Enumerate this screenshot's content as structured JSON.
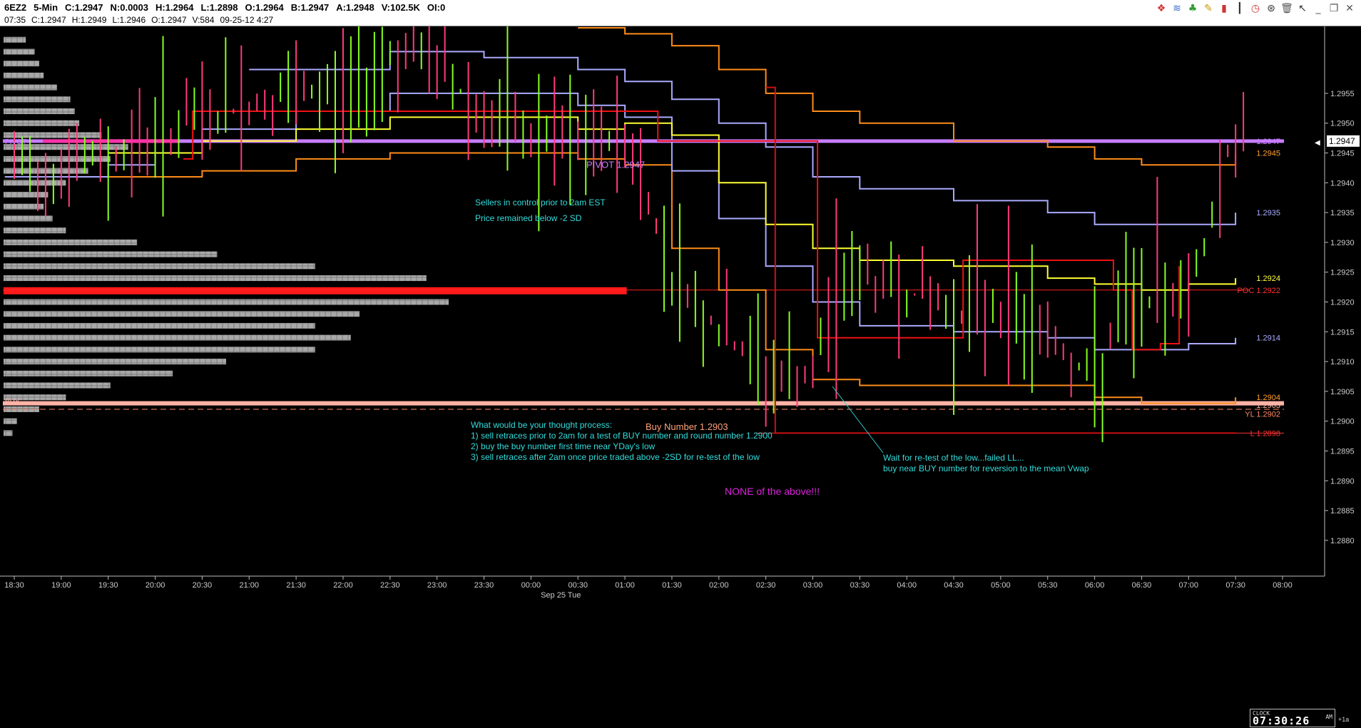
{
  "header": {
    "symbol": "6EZ2",
    "interval": "5-Min",
    "close": "C:1.2947",
    "net": "N:0.0003",
    "high": "H:1.2964",
    "low": "L:1.2898",
    "open": "O:1.2964",
    "bid": "B:1.2947",
    "ask": "A:1.2948",
    "volume": "V:102.5K",
    "open_interest": "OI:0"
  },
  "bar_info": {
    "time": "07:35",
    "close": "C:1.2947",
    "high": "H:1.2949",
    "low": "L:1.2946",
    "open": "O:1.2947",
    "volume": "V:584",
    "date_time": "09-25-12  4:27"
  },
  "toolbar": [
    "layers-icon",
    "waves-icon",
    "tree-icon",
    "pencil-icon",
    "bar-chart-icon",
    "candle-icon",
    "clock-icon",
    "stopwatch-icon",
    "trash-icon",
    "cursor-icon",
    "minimize-icon",
    "restore-icon",
    "close-icon"
  ],
  "toolbar_glyphs": [
    "❖",
    "≋",
    "♣",
    "✎",
    "▮",
    "┃",
    "◷",
    "⊛",
    "🗑",
    "↖",
    "_",
    "❐",
    "✕"
  ],
  "chart_data": {
    "type": "line",
    "price_axis": {
      "ylim": [
        1.2874,
        1.2966
      ],
      "ticks": [
        "1.2955",
        "1.2950",
        "1.2945",
        "1.2940",
        "1.2935",
        "1.2930",
        "1.2925",
        "1.2920",
        "1.2915",
        "1.2910",
        "1.2905",
        "1.2900",
        "1.2895",
        "1.2890",
        "1.2885",
        "1.2880"
      ],
      "last_price": "1.2947"
    },
    "time_axis": {
      "ticks": [
        "18:30",
        "19:00",
        "19:30",
        "20:00",
        "20:30",
        "21:00",
        "21:30",
        "22:00",
        "22:30",
        "23:00",
        "23:30",
        "00:00",
        "00:30",
        "01:00",
        "01:30",
        "02:00",
        "02:30",
        "03:00",
        "03:30",
        "04:00",
        "04:30",
        "05:00",
        "05:30",
        "06:00",
        "06:30",
        "07:00",
        "07:30",
        "08:00"
      ],
      "date_label": "Sep 25 Tue"
    },
    "levels": [
      {
        "name": "pivot",
        "left_label": "PIVOT",
        "mid_label": "PIVOT 1.2947",
        "right_label": "1.2947",
        "price": 1.2947,
        "color": "#c77dff"
      },
      {
        "name": "poc",
        "right_label": "POC 1.2922",
        "price": 1.2922,
        "color": "#ff2222"
      },
      {
        "name": "buy",
        "left_label": "BUY",
        "mid_label": "Buy Number 1.2903",
        "right_label": "1.2903",
        "price": 1.2903,
        "color": "#ffb3a7"
      },
      {
        "name": "yday-low",
        "right_label": "YL 1.2902",
        "price": 1.2902,
        "color": "#ff8866"
      },
      {
        "name": "low",
        "right_label": "L 1.2898",
        "price": 1.2898,
        "color": "#ff3333"
      }
    ],
    "band_labels": [
      {
        "text": "1.2945",
        "price": 1.2945,
        "color": "#ffa030"
      },
      {
        "text": "1.2935",
        "price": 1.2935,
        "color": "#aaaaff"
      },
      {
        "text": "1.2924",
        "price": 1.2924,
        "color": "#ffff40"
      },
      {
        "text": "1.2914",
        "price": 1.2914,
        "color": "#aaaaff"
      },
      {
        "text": "1.2904",
        "price": 1.2904,
        "color": "#ffa030"
      }
    ],
    "series": [
      {
        "name": "vwap-band-upper-2",
        "color": "#ff8c1a",
        "values": [
          [
            18.4,
            1.2941
          ],
          [
            19.5,
            1.2941
          ],
          [
            20.5,
            1.2942
          ],
          [
            21.5,
            1.2944
          ],
          [
            22.5,
            1.2945
          ],
          [
            23.5,
            1.2945
          ],
          [
            0.5,
            1.2944
          ],
          [
            1.0,
            1.2943
          ],
          [
            1.5,
            1.2929
          ],
          [
            2.0,
            1.2922
          ],
          [
            2.5,
            1.2912
          ],
          [
            3.0,
            1.2907
          ],
          [
            3.5,
            1.2906
          ],
          [
            4.5,
            1.2906
          ],
          [
            5.5,
            1.2906
          ],
          [
            6.0,
            1.2904
          ],
          [
            6.5,
            1.2903
          ],
          [
            7.0,
            1.2903
          ],
          [
            7.5,
            1.2904
          ]
        ]
      },
      {
        "name": "vwap-band-upper-1",
        "color": "#aaaaff",
        "values": [
          [
            18.4,
            1.2941
          ],
          [
            19.5,
            1.2943
          ],
          [
            20.0,
            1.2945
          ],
          [
            20.5,
            1.2949
          ],
          [
            21.5,
            1.2952
          ],
          [
            22.5,
            1.2955
          ],
          [
            23.5,
            1.2955
          ],
          [
            0.5,
            1.2953
          ],
          [
            1.0,
            1.2951
          ],
          [
            1.5,
            1.2942
          ],
          [
            2.0,
            1.2934
          ],
          [
            2.5,
            1.2926
          ],
          [
            3.0,
            1.292
          ],
          [
            3.5,
            1.2916
          ],
          [
            4.5,
            1.2915
          ],
          [
            5.5,
            1.2914
          ],
          [
            6.0,
            1.2912
          ],
          [
            6.5,
            1.2912
          ],
          [
            7.0,
            1.2913
          ],
          [
            7.5,
            1.2914
          ]
        ]
      },
      {
        "name": "vwap",
        "color": "#ffff33",
        "values": [
          [
            19.5,
            1.2945
          ],
          [
            20.5,
            1.2947
          ],
          [
            21.5,
            1.2949
          ],
          [
            22.5,
            1.2951
          ],
          [
            23.5,
            1.2951
          ],
          [
            0.5,
            1.2949
          ],
          [
            1.0,
            1.295
          ],
          [
            1.5,
            1.2948
          ],
          [
            2.0,
            1.294
          ],
          [
            2.5,
            1.2933
          ],
          [
            3.0,
            1.2929
          ],
          [
            3.5,
            1.2927
          ],
          [
            4.5,
            1.2926
          ],
          [
            5.5,
            1.2924
          ],
          [
            6.0,
            1.2923
          ],
          [
            6.5,
            1.2922
          ],
          [
            7.0,
            1.2923
          ],
          [
            7.5,
            1.2924
          ]
        ]
      },
      {
        "name": "vwap-band-lower-1",
        "color": "#aaaaff",
        "values": [
          [
            21.0,
            1.2959
          ],
          [
            22.5,
            1.2962
          ],
          [
            23.5,
            1.2961
          ],
          [
            0.5,
            1.2959
          ],
          [
            1.0,
            1.2957
          ],
          [
            1.5,
            1.2954
          ],
          [
            2.0,
            1.295
          ],
          [
            2.5,
            1.2946
          ],
          [
            3.0,
            1.2941
          ],
          [
            3.5,
            1.2939
          ],
          [
            4.5,
            1.2937
          ],
          [
            5.5,
            1.2935
          ],
          [
            6.0,
            1.2933
          ],
          [
            6.5,
            1.2933
          ],
          [
            7.0,
            1.2933
          ],
          [
            7.5,
            1.2935
          ]
        ]
      },
      {
        "name": "vwap-band-lower-2",
        "color": "#ff8c1a",
        "values": [
          [
            0.5,
            1.2966
          ],
          [
            1.0,
            1.2965
          ],
          [
            1.5,
            1.2963
          ],
          [
            2.0,
            1.2959
          ],
          [
            2.5,
            1.2955
          ],
          [
            3.0,
            1.2952
          ],
          [
            3.5,
            1.295
          ],
          [
            4.5,
            1.2947
          ],
          [
            5.5,
            1.2946
          ],
          [
            6.0,
            1.2944
          ],
          [
            6.5,
            1.2943
          ],
          [
            7.0,
            1.2943
          ],
          [
            7.5,
            1.2945
          ]
        ]
      },
      {
        "name": "swing-line",
        "color": "#ee1111",
        "values": [
          [
            20.3,
            1.2944
          ],
          [
            20.4,
            1.2952
          ],
          [
            23.5,
            1.2952
          ],
          [
            1.3,
            1.2952
          ],
          [
            1.35,
            1.2947
          ],
          [
            3.0,
            1.2947
          ],
          [
            3.05,
            1.2914
          ],
          [
            4.4,
            1.2914
          ],
          [
            4.6,
            1.2927
          ],
          [
            6.2,
            1.2922
          ],
          [
            6.4,
            1.2912
          ],
          [
            6.7,
            1.2913
          ],
          [
            6.9,
            1.2926
          ]
        ]
      },
      {
        "name": "low-line",
        "color": "#cc1111",
        "values": [
          [
            2.5,
            1.2956
          ],
          [
            2.6,
            1.2898
          ],
          [
            7.5,
            1.2898
          ]
        ]
      }
    ],
    "annotations": [
      {
        "lines": [
          "Sellers in control prior to 2am EST",
          "",
          "Price remained below -2 SD"
        ],
        "color": "#33dddd"
      },
      {
        "lines": [
          "What would be your thought process:",
          "1)  sell retraces prior to 2am for a test of BUY number and round number 1.2900",
          "2)  buy the buy number first time near YDay's low",
          "3)  sell retraces after 2am once price traded above -2SD for re-test of the low"
        ],
        "color": "#33dddd"
      },
      {
        "lines": [
          "Wait for re-test of the low...failed LL...",
          "buy near BUY number for reversion to the mean Vwap"
        ],
        "color": "#33dddd"
      },
      {
        "lines": [
          "NONE of the above!!!"
        ],
        "color": "#dd22dd"
      }
    ],
    "volume_profile": {
      "poc_price": 1.2922,
      "bins": [
        [
          1.2964,
          5
        ],
        [
          1.2962,
          7
        ],
        [
          1.296,
          8
        ],
        [
          1.2958,
          9
        ],
        [
          1.2956,
          12
        ],
        [
          1.2954,
          15
        ],
        [
          1.2952,
          16
        ],
        [
          1.295,
          17
        ],
        [
          1.2948,
          22
        ],
        [
          1.2946,
          28
        ],
        [
          1.2944,
          24
        ],
        [
          1.2942,
          19
        ],
        [
          1.294,
          14
        ],
        [
          1.2938,
          10
        ],
        [
          1.2936,
          9
        ],
        [
          1.2934,
          11
        ],
        [
          1.2932,
          14
        ],
        [
          1.293,
          30
        ],
        [
          1.2928,
          48
        ],
        [
          1.2926,
          70
        ],
        [
          1.2924,
          95
        ],
        [
          1.2922,
          140
        ],
        [
          1.292,
          100
        ],
        [
          1.2918,
          80
        ],
        [
          1.2916,
          70
        ],
        [
          1.2914,
          78
        ],
        [
          1.2912,
          70
        ],
        [
          1.291,
          50
        ],
        [
          1.2908,
          38
        ],
        [
          1.2906,
          24
        ],
        [
          1.2904,
          14
        ],
        [
          1.2902,
          8
        ],
        [
          1.29,
          3
        ],
        [
          1.2898,
          2
        ]
      ]
    },
    "time_clock": "07:30:26",
    "clock_label": "CLOCK",
    "clock_ampm": "AM",
    "tz_label": "+1a"
  }
}
